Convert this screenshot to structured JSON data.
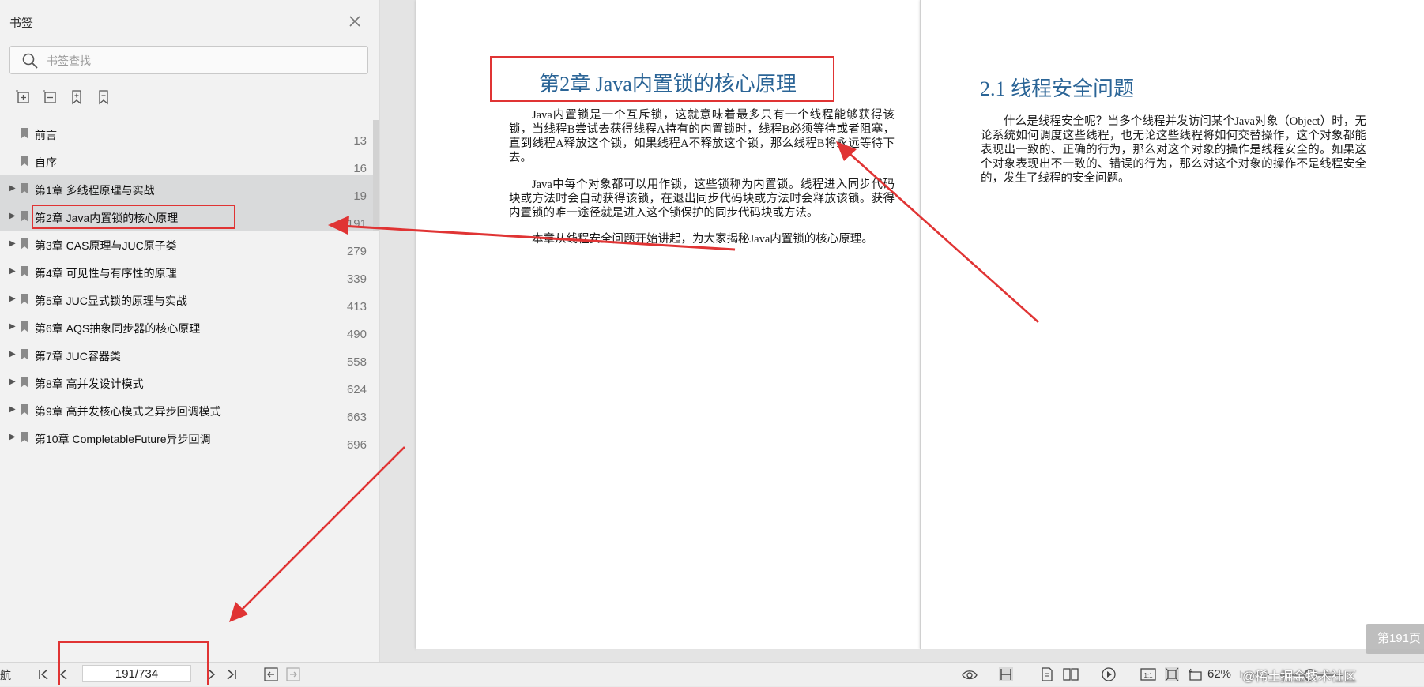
{
  "sidebar": {
    "title": "书签",
    "search_placeholder": "书签查找",
    "items": [
      {
        "label": "前言",
        "page": "13",
        "expandable": false,
        "highlight": false
      },
      {
        "label": "自序",
        "page": "16",
        "expandable": false,
        "highlight": false
      },
      {
        "label": "第1章 多线程原理与实战",
        "page": "19",
        "expandable": true,
        "highlight": true
      },
      {
        "label": "第2章 Java内置锁的核心原理",
        "page": "191",
        "expandable": true,
        "highlight": true
      },
      {
        "label": "第3章 CAS原理与JUC原子类",
        "page": "279",
        "expandable": true,
        "highlight": false
      },
      {
        "label": "第4章 可见性与有序性的原理",
        "page": "339",
        "expandable": true,
        "highlight": false
      },
      {
        "label": "第5章 JUC显式锁的原理与实战",
        "page": "413",
        "expandable": true,
        "highlight": false
      },
      {
        "label": "第6章 AQS抽象同步器的核心原理",
        "page": "490",
        "expandable": true,
        "highlight": false
      },
      {
        "label": "第7章 JUC容器类",
        "page": "558",
        "expandable": true,
        "highlight": false
      },
      {
        "label": "第8章 高并发设计模式",
        "page": "624",
        "expandable": true,
        "highlight": false
      },
      {
        "label": "第9章 高并发核心模式之异步回调模式",
        "page": "663",
        "expandable": true,
        "highlight": false
      },
      {
        "label": "第10章 CompletableFuture异步回调",
        "page": "696",
        "expandable": true,
        "highlight": false
      }
    ]
  },
  "document": {
    "left_page": {
      "chapter_title": "第2章    Java内置锁的核心原理",
      "paragraphs": [
        "Java内置锁是一个互斥锁，这就意味着最多只有一个线程能够获得该锁，当线程B尝试去获得线程A持有的内置锁时，线程B必须等待或者阻塞，直到线程A释放这个锁，如果线程A不释放这个锁，那么线程B将永远等待下去。",
        "Java中每个对象都可以用作锁，这些锁称为内置锁。线程进入同步代码块或方法时会自动获得该锁，在退出同步代码块或方法时会释放该锁。获得内置锁的唯一途径就是进入这个锁保护的同步代码块或方法。",
        "本章从线程安全问题开始讲起，为大家揭秘Java内置锁的核心原理。"
      ]
    },
    "right_page": {
      "section_title": "2.1    线程安全问题",
      "paragraph": "什么是线程安全呢？当多个线程并发访问某个Java对象（Object）时，无论系统如何调度这些线程，也无论这些线程将如何交替操作，这个对象都能表现出一致的、正确的行为，那么对这个对象的操作是线程安全的。如果这个对象表现出不一致的、错误的行为，那么对这个对象的操作不是线程安全的，发生了线程的安全问题。"
    },
    "page_badge": "第191页"
  },
  "bottombar": {
    "nav_label": "航",
    "page_value": "191/734",
    "zoom": "62%",
    "watermark": "@稀土掘金技术社区",
    "watermark_url": "https://"
  },
  "colors": {
    "accent_blue": "#2a6496",
    "annotation_red": "#e03434",
    "highlight_row": "#d9dadb"
  }
}
